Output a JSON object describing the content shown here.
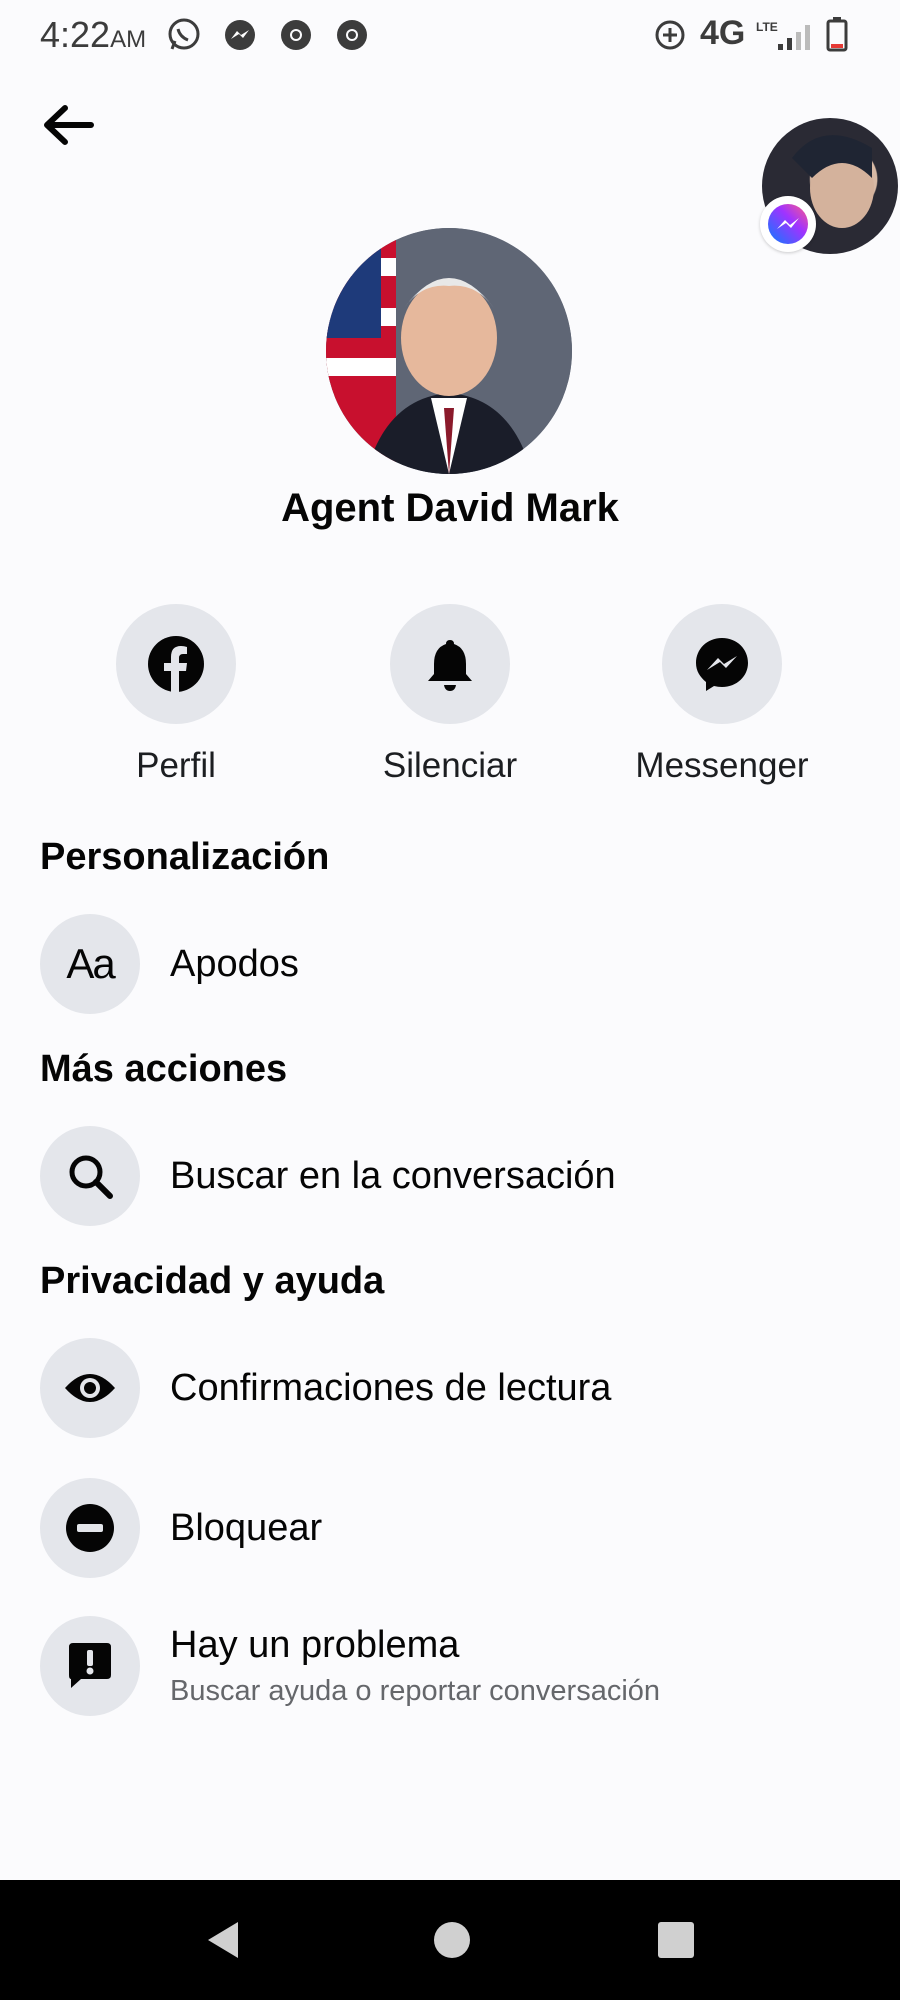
{
  "status_bar": {
    "time": "4:22",
    "ampm": "AM",
    "network": "4G",
    "network_small": "LTE",
    "notification_icons": [
      "whatsapp-icon",
      "messenger-icon",
      "chrome-icon",
      "chrome-icon"
    ]
  },
  "profile": {
    "name": "Agent David Mark"
  },
  "actions": [
    {
      "label": "Perfil",
      "icon": "facebook-icon"
    },
    {
      "label": "Silenciar",
      "icon": "bell-icon"
    },
    {
      "label": "Messenger",
      "icon": "messenger-icon"
    }
  ],
  "sections": {
    "personalization": {
      "title": "Personalización",
      "items": [
        {
          "label": "Apodos",
          "icon": "text-aa-icon"
        }
      ]
    },
    "more_actions": {
      "title": "Más acciones",
      "items": [
        {
          "label": "Buscar en la conversación",
          "icon": "search-icon"
        }
      ]
    },
    "privacy": {
      "title": "Privacidad y ayuda",
      "items": [
        {
          "label": "Confirmaciones de lectura",
          "icon": "eye-icon"
        },
        {
          "label": "Bloquear",
          "icon": "minus-circle-icon"
        },
        {
          "label": "Hay un problema",
          "sublabel": "Buscar ayuda o reportar conversación",
          "icon": "report-icon"
        }
      ]
    }
  },
  "colors": {
    "background": "#fbfbfd",
    "icon_circle": "#e4e6eb",
    "text_primary": "#050505",
    "text_secondary": "#65676b"
  }
}
